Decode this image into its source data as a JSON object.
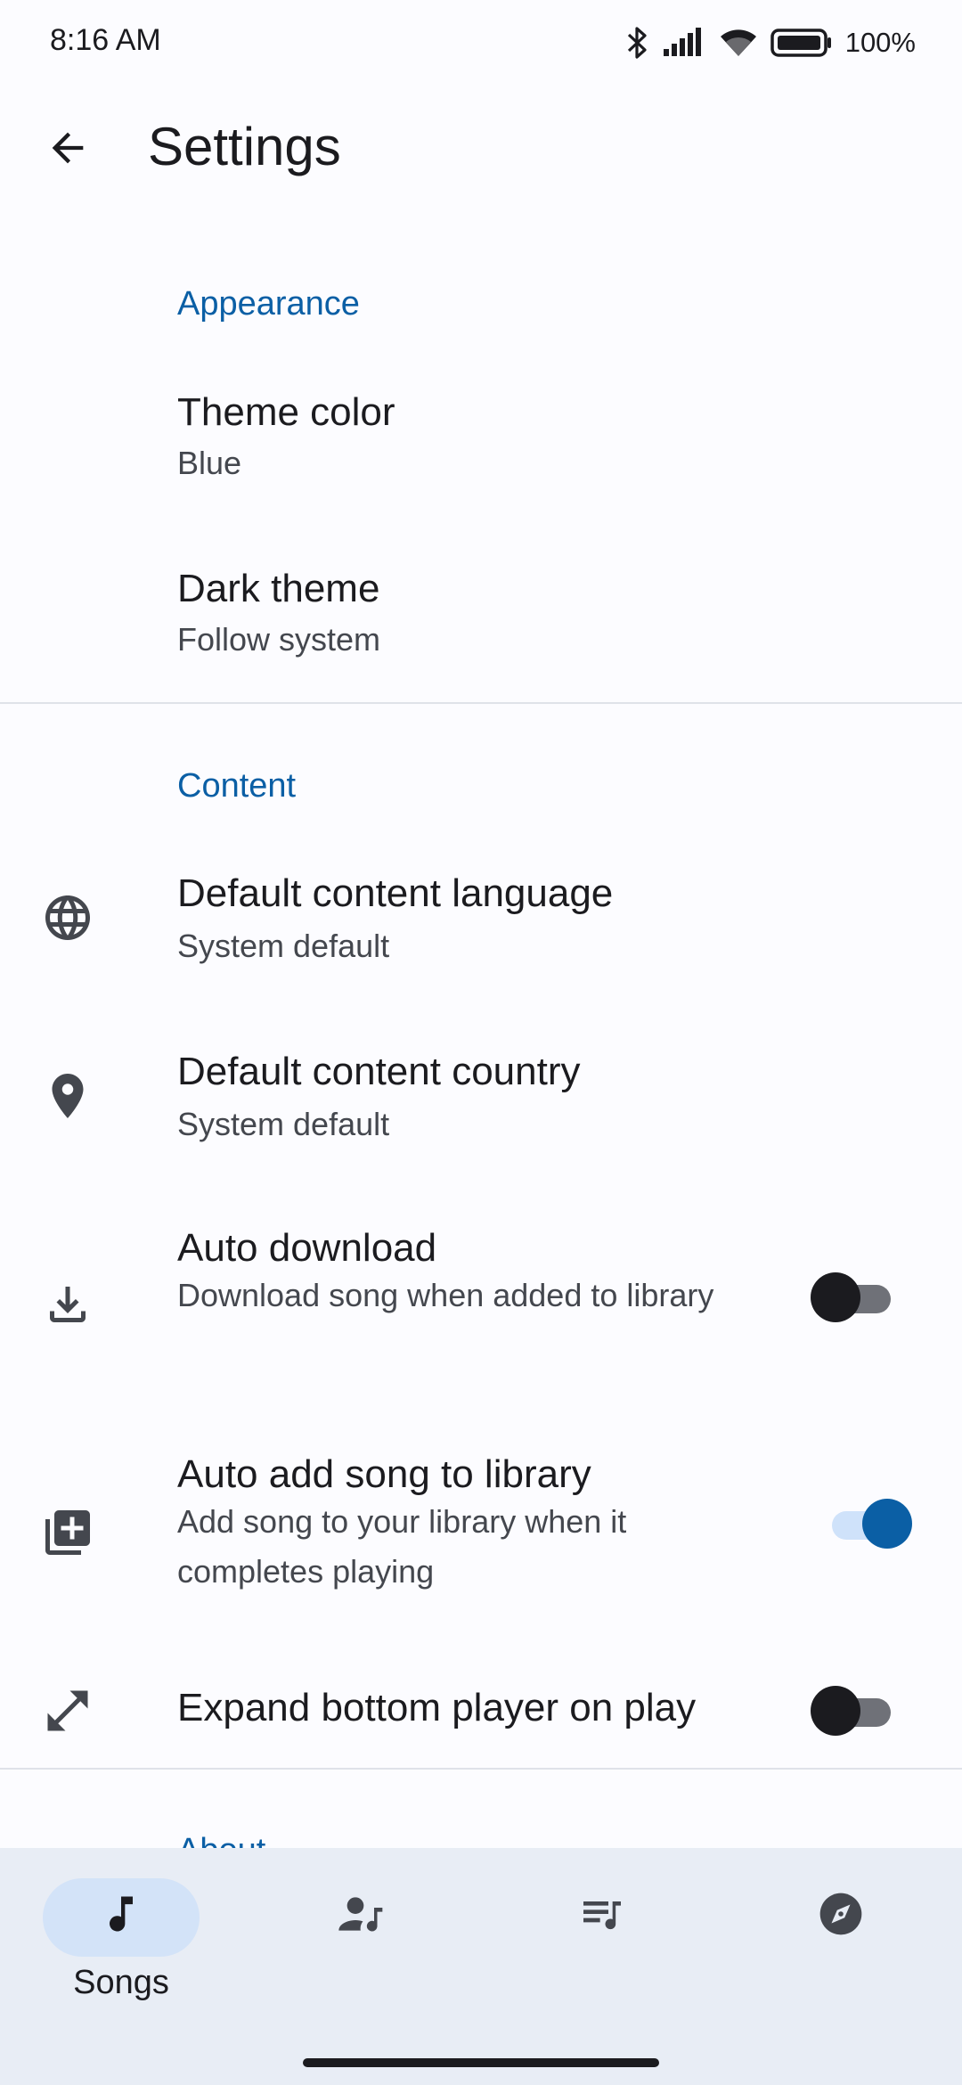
{
  "status_bar": {
    "time": "8:16 AM",
    "battery_percent": "100%"
  },
  "app_bar": {
    "title": "Settings"
  },
  "sections": {
    "appearance": {
      "header": "Appearance",
      "items": [
        {
          "title": "Theme color",
          "subtitle": "Blue"
        },
        {
          "title": "Dark theme",
          "subtitle": "Follow system"
        }
      ]
    },
    "content": {
      "header": "Content",
      "items": [
        {
          "title": "Default content language",
          "subtitle": "System default",
          "icon": "globe-icon"
        },
        {
          "title": "Default content country",
          "subtitle": "System default",
          "icon": "location-pin-icon"
        },
        {
          "title": "Auto download",
          "subtitle": "Download song when added to library",
          "icon": "download-icon",
          "switch_on": false
        },
        {
          "title": "Auto add song to library",
          "subtitle": "Add song to your library when it completes playing",
          "icon": "library-add-icon",
          "switch_on": true
        },
        {
          "title": "Expand bottom player on play",
          "icon": "expand-icon",
          "switch_on": false
        }
      ]
    },
    "about": {
      "header": "About"
    }
  },
  "bottom_nav": {
    "items": [
      {
        "label": "Songs",
        "icon": "music-note-icon",
        "active": true
      },
      {
        "label": "",
        "icon": "artist-icon",
        "active": false
      },
      {
        "label": "",
        "icon": "playlist-icon",
        "active": false
      },
      {
        "label": "",
        "icon": "explore-icon",
        "active": false
      }
    ]
  },
  "colors": {
    "accent": "#0b5fa5",
    "background": "#fcfcff",
    "nav_background": "#e8edf5"
  }
}
